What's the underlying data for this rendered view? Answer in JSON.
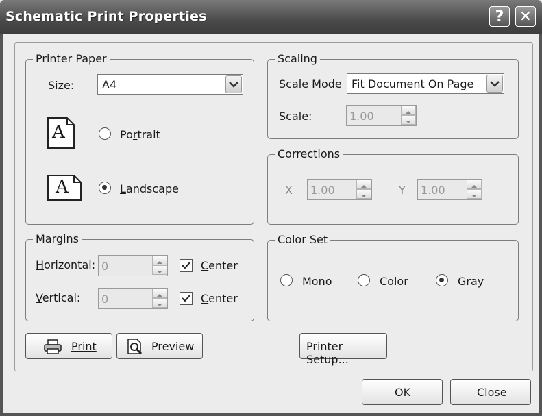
{
  "window": {
    "title": "Schematic Print Properties",
    "help_label": "?",
    "close_label": "✕"
  },
  "printer_paper": {
    "legend": "Printer Paper",
    "size_label": "Size:",
    "size_value": "A4",
    "portrait_icon_letter": "A",
    "landscape_icon_letter": "A",
    "portrait_label": "Portrait",
    "landscape_label": "Landscape",
    "orientation_selected": "Landscape"
  },
  "margins": {
    "legend": "Margins",
    "horizontal_label": "Horizontal:",
    "horizontal_value": "0",
    "horizontal_center_label": "Center",
    "horizontal_center_checked": true,
    "vertical_label": "Vertical:",
    "vertical_value": "0",
    "vertical_center_label": "Center",
    "vertical_center_checked": true
  },
  "scaling": {
    "legend": "Scaling",
    "mode_label": "Scale Mode",
    "mode_value": "Fit Document On Page",
    "scale_label": "Scale:",
    "scale_value": "1.00"
  },
  "corrections": {
    "legend": "Corrections",
    "x_label": "X",
    "x_value": "1.00",
    "y_label": "Y",
    "y_value": "1.00"
  },
  "color_set": {
    "legend": "Color Set",
    "options": [
      "Mono",
      "Color",
      "Gray"
    ],
    "selected": "Gray"
  },
  "buttons": {
    "print": "Print",
    "preview": "Preview",
    "printer_setup": "Printer Setup...",
    "ok": "OK",
    "close": "Close"
  }
}
